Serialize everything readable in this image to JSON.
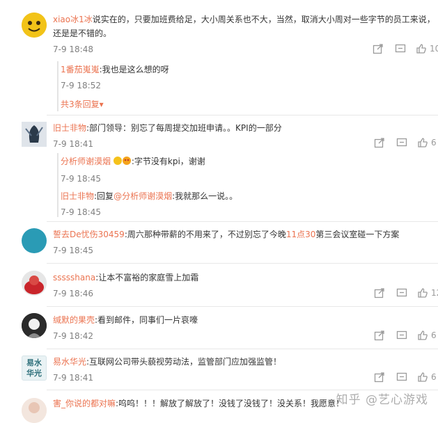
{
  "comments": [
    {
      "user": "xiao冰1冰",
      "text_lines": [
        "说实在的，只要加班费给足，大小周关系也不大，当然，取消大小周对一些字节的员工来说，",
        "还是是不错的。"
      ],
      "time": "7-9 18:48",
      "like_count": "10",
      "replies": [
        {
          "user": "1番茄嵬嵬",
          "text": ":我也是这么想的呀",
          "time": "7-9 18:52"
        }
      ],
      "more_replies": "共3条回复▾"
    },
    {
      "user": "旧士非物",
      "text": ":部门领导：别忘了每周提交加班申请。。KPI的一部分",
      "time": "7-9 18:41",
      "like_count": "6",
      "replies": [
        {
          "user": "分析师谢漠烟",
          "text": ":字节没有kpi，谢谢",
          "time": "7-9 18:45"
        },
        {
          "user": "旧士非物",
          "text_prefix": ":回复",
          "mention": "@分析师谢漠烟",
          "text": ":我就那么一说。。",
          "time": "7-9 18:45"
        }
      ]
    },
    {
      "user": "誓去De忧伤30459",
      "text_prefix": ":周六那种带薪的不用来了，不过别忘了今晚",
      "hl1": "11点30",
      "text": "第三会议室碰一下方案",
      "time": "7-9 18:45"
    },
    {
      "user": "ssssshana",
      "text": ":让本不富裕的家庭雪上加霜",
      "time": "7-9 18:46",
      "like_count": "12"
    },
    {
      "user": "缄默的果壳",
      "text": ":看到邮件，同事们一片哀嚎",
      "time": "7-9 18:42",
      "like_count": "6"
    },
    {
      "user": "易水华光",
      "text": ":互联网公司带头藐视劳动法，监管部门应加强监管！",
      "time": "7-9 18:41",
      "like_count": "6",
      "avatar_text": [
        "易水",
        "华光"
      ]
    },
    {
      "user": "害_你说的都对嘛",
      "text": ":呜呜！！！解放了解放了！没钱了没钱了！没关系！我愿意！"
    }
  ],
  "watermark": "知乎 @艺心游戏",
  "colors": {
    "accent": "#eb7350",
    "text": "#333333",
    "muted": "#808080"
  }
}
